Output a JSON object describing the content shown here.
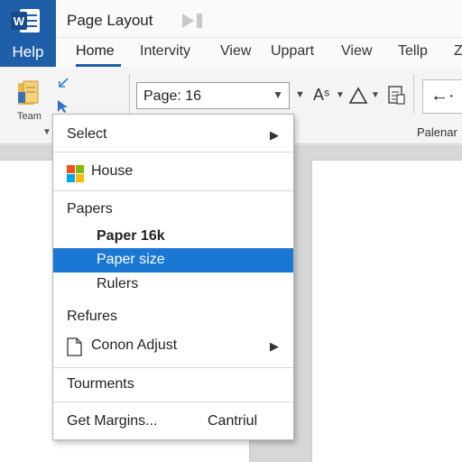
{
  "app": {
    "help_label": "Help",
    "title": "Page Layout"
  },
  "tabs": [
    "Home",
    "Intervity",
    "View",
    "Uppart",
    "View",
    "Tellp",
    "Z"
  ],
  "ribbon": {
    "team_label": "Team",
    "page_combo_value": "Page: 16",
    "font_size_glyph": "Aˢ",
    "arrow_glyph": "←·",
    "group_label": "Palenar"
  },
  "menu": {
    "select": "Select",
    "house": "House",
    "papers_header": "Papers",
    "paper_16k": "Paper 16k",
    "paper_size": "Paper size",
    "rulers": "Rulers",
    "refures": "Refures",
    "conon_adjust": "Conon Adjust",
    "tourments": "Tourments",
    "get_margins": "Get Margins...",
    "get_margins_shortcut": "Cantriul"
  },
  "colors": {
    "word_blue": "#1f5ea8",
    "selection": "#1a78d4"
  }
}
